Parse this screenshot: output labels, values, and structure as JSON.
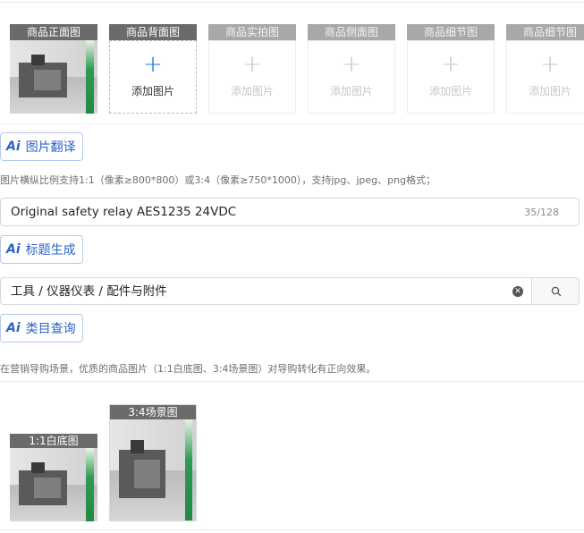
{
  "image_slots": [
    {
      "label": "商品正面图",
      "has_image": true
    },
    {
      "label": "商品背面图",
      "has_image": false,
      "active": true,
      "add_text": "添加图片"
    },
    {
      "label": "商品实拍图",
      "has_image": false,
      "active": false,
      "add_text": "添加图片"
    },
    {
      "label": "商品侧面图",
      "has_image": false,
      "active": false,
      "add_text": "添加图片"
    },
    {
      "label": "商品细节图",
      "has_image": false,
      "active": false,
      "add_text": "添加图片"
    },
    {
      "label": "商品细节图",
      "has_image": false,
      "active": false,
      "add_text": "添加图片"
    }
  ],
  "ai_image_translate": {
    "icon": "Ai",
    "label": "图片翻译"
  },
  "image_hint": "图片横纵比例支持1:1（像素≥800*800）或3:4（像素≥750*1000），支持jpg、jpeg、png格式；",
  "title_field": {
    "value": "Original safety relay AES1235 24VDC",
    "count": "35/128"
  },
  "ai_title_generate": {
    "icon": "Ai",
    "label": "标题生成"
  },
  "category_field": {
    "value": "工具 / 仪器仪表 / 配件与附件"
  },
  "ai_category_query": {
    "icon": "Ai",
    "label": "类目查询"
  },
  "marketing_hint": "在营销导购场景，优质的商品图片（1:1白底图、3:4场景图）对导购转化有正向效果。",
  "marketing_images": [
    {
      "label": "1:1白底图"
    },
    {
      "label": "3:4场景图"
    }
  ]
}
